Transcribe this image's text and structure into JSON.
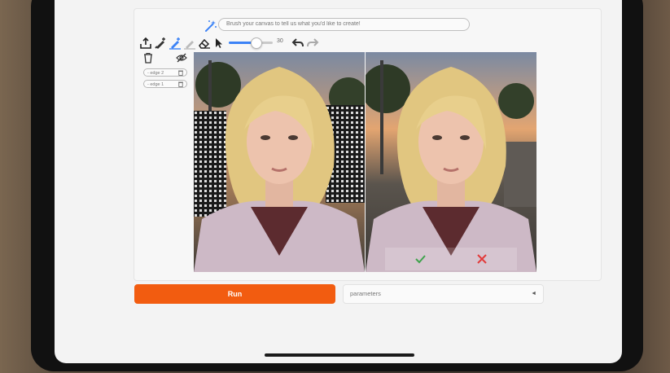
{
  "prompt": {
    "placeholder": "Brush your canvas to tell us what you'd like to create!"
  },
  "toolbar": {
    "brush_size": "30"
  },
  "layers": [
    {
      "label": "- edge 2"
    },
    {
      "label": "- edge 1"
    }
  ],
  "actions": {
    "run_label": "Run",
    "parameters_label": "parameters",
    "caret": "◄"
  },
  "colors": {
    "accent_blue": "#3b82f6",
    "run_orange": "#f25c10",
    "confirm_green": "#3fa34d",
    "reject_red": "#e23b3b"
  }
}
